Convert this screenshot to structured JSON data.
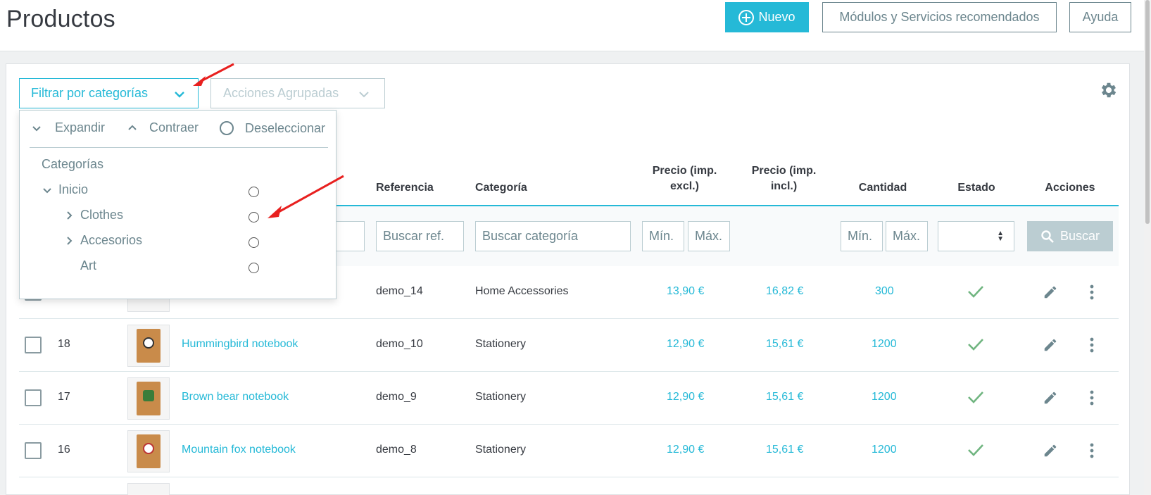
{
  "header": {
    "title": "Productos",
    "new_button": "Nuevo",
    "modules_button": "Módulos y Servicios recomendados",
    "help_button": "Ayuda"
  },
  "toolbar": {
    "filter_categories": "Filtrar por categorías",
    "bulk_actions": "Acciones Agrupadas"
  },
  "category_dropdown": {
    "expand": "Expandir",
    "collapse": "Contraer",
    "deselect": "Deseleccionar",
    "heading": "Categorías",
    "tree": [
      {
        "label": "Inicio"
      },
      {
        "label": "Clothes"
      },
      {
        "label": "Accesorios"
      },
      {
        "label": "Art"
      }
    ]
  },
  "table": {
    "headers": {
      "reference": "Referencia",
      "category": "Categoría",
      "price_excl_1": "Precio (imp.",
      "price_excl_2": "excl.)",
      "price_incl_1": "Precio (imp.",
      "price_incl_2": "incl.)",
      "quantity": "Cantidad",
      "status": "Estado",
      "actions": "Acciones"
    },
    "filters": {
      "reference_placeholder": "Buscar ref.",
      "category_placeholder": "Buscar categoría",
      "min": "Mín.",
      "max": "Máx.",
      "search_button": "Buscar"
    },
    "rows": [
      {
        "id": "",
        "name": "",
        "reference": "demo_14",
        "category": "Home Accessories",
        "price_excl": "13,90 €",
        "price_incl": "16,82 €",
        "quantity": "300"
      },
      {
        "id": "18",
        "name": "Hummingbird notebook",
        "reference": "demo_10",
        "category": "Stationery",
        "price_excl": "12,90 €",
        "price_incl": "15,61 €",
        "quantity": "1200"
      },
      {
        "id": "17",
        "name": "Brown bear notebook",
        "reference": "demo_9",
        "category": "Stationery",
        "price_excl": "12,90 €",
        "price_incl": "15,61 €",
        "quantity": "1200"
      },
      {
        "id": "16",
        "name": "Mountain fox notebook",
        "reference": "demo_8",
        "category": "Stationery",
        "price_excl": "12,90 €",
        "price_incl": "15,61 €",
        "quantity": "1200"
      }
    ]
  },
  "colors": {
    "primary": "#25b9d7",
    "success": "#70b580",
    "muted": "#6c868e",
    "border": "#bbcdd2",
    "annotation": "#e8201f"
  }
}
